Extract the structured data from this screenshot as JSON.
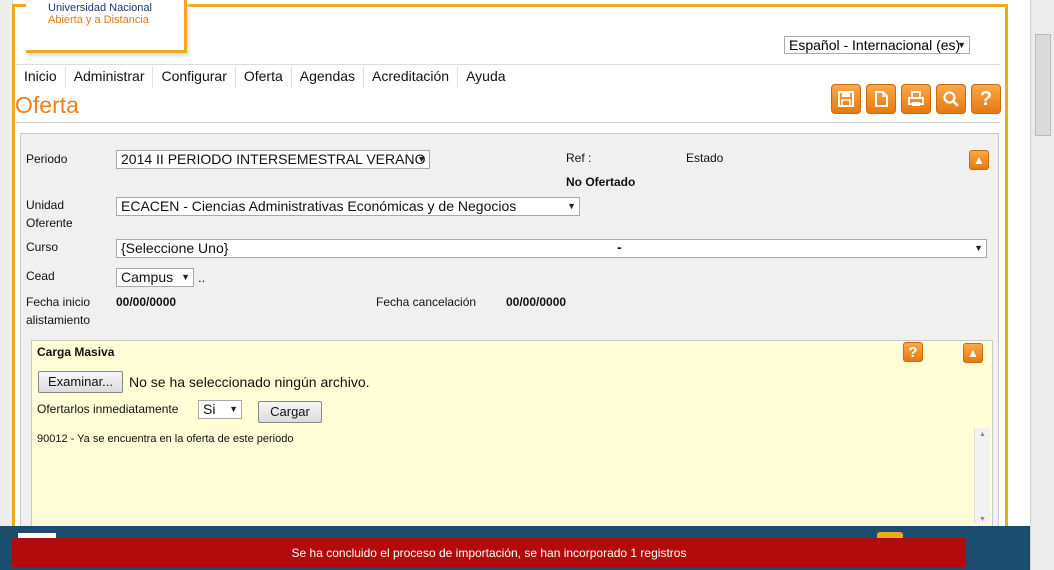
{
  "brand": {
    "line1": "Universidad Nacional",
    "line2": "Abierta y a  Distancia"
  },
  "language": {
    "selected": "Español - Internacional (es)"
  },
  "nav": [
    "Inicio",
    "Administrar",
    "Configurar",
    "Oferta",
    "Agendas",
    "Acreditación",
    "Ayuda"
  ],
  "page_title": "Oferta",
  "toolbar": {
    "icons": [
      "save-icon",
      "new-document-icon",
      "print-icon",
      "search-icon",
      "help-icon"
    ]
  },
  "form": {
    "periodo_label": "Periodo",
    "periodo_value": "2014 II PERIODO INTERSEMESTRAL VERANO",
    "ref_label": "Ref :",
    "estado_label": "Estado",
    "status_value": "No Ofertado",
    "unidad_label_1": "Unidad",
    "unidad_label_2": "Oferente",
    "unidad_value": "ECACEN - Ciencias Administrativas Económicas y de Negocios",
    "curso_label": "Curso",
    "curso_value": "{Seleccione Uno}",
    "curso_dash": "-",
    "cead_label": "Cead",
    "cead_value": "Campus",
    "cead_suffix": "..",
    "fecha_inicio_label_1": "Fecha inicio",
    "fecha_inicio_label_2": "alistamiento",
    "fecha_inicio_value": "00/00/0000",
    "fecha_cancel_label": "Fecha cancelación",
    "fecha_cancel_value": "00/00/0000"
  },
  "carga": {
    "title": "Carga Masiva",
    "browse_label": "Examinar...",
    "no_file": "No se ha seleccionado ningún archivo.",
    "ofertar_label": "Ofertarlos inmediatamente",
    "ofertar_value": "Si",
    "cargar_label": "Cargar",
    "log": "90012 - Ya se encuentra en la oferta de este periodo"
  },
  "notice": "Se ha concluido el proceso de importación, se han incorporado 1 registros",
  "colors": {
    "accent": "#f2a81e",
    "title": "#f07f1c",
    "notice_bg": "#b10b0b",
    "panel_yellow": "#fffed6"
  }
}
